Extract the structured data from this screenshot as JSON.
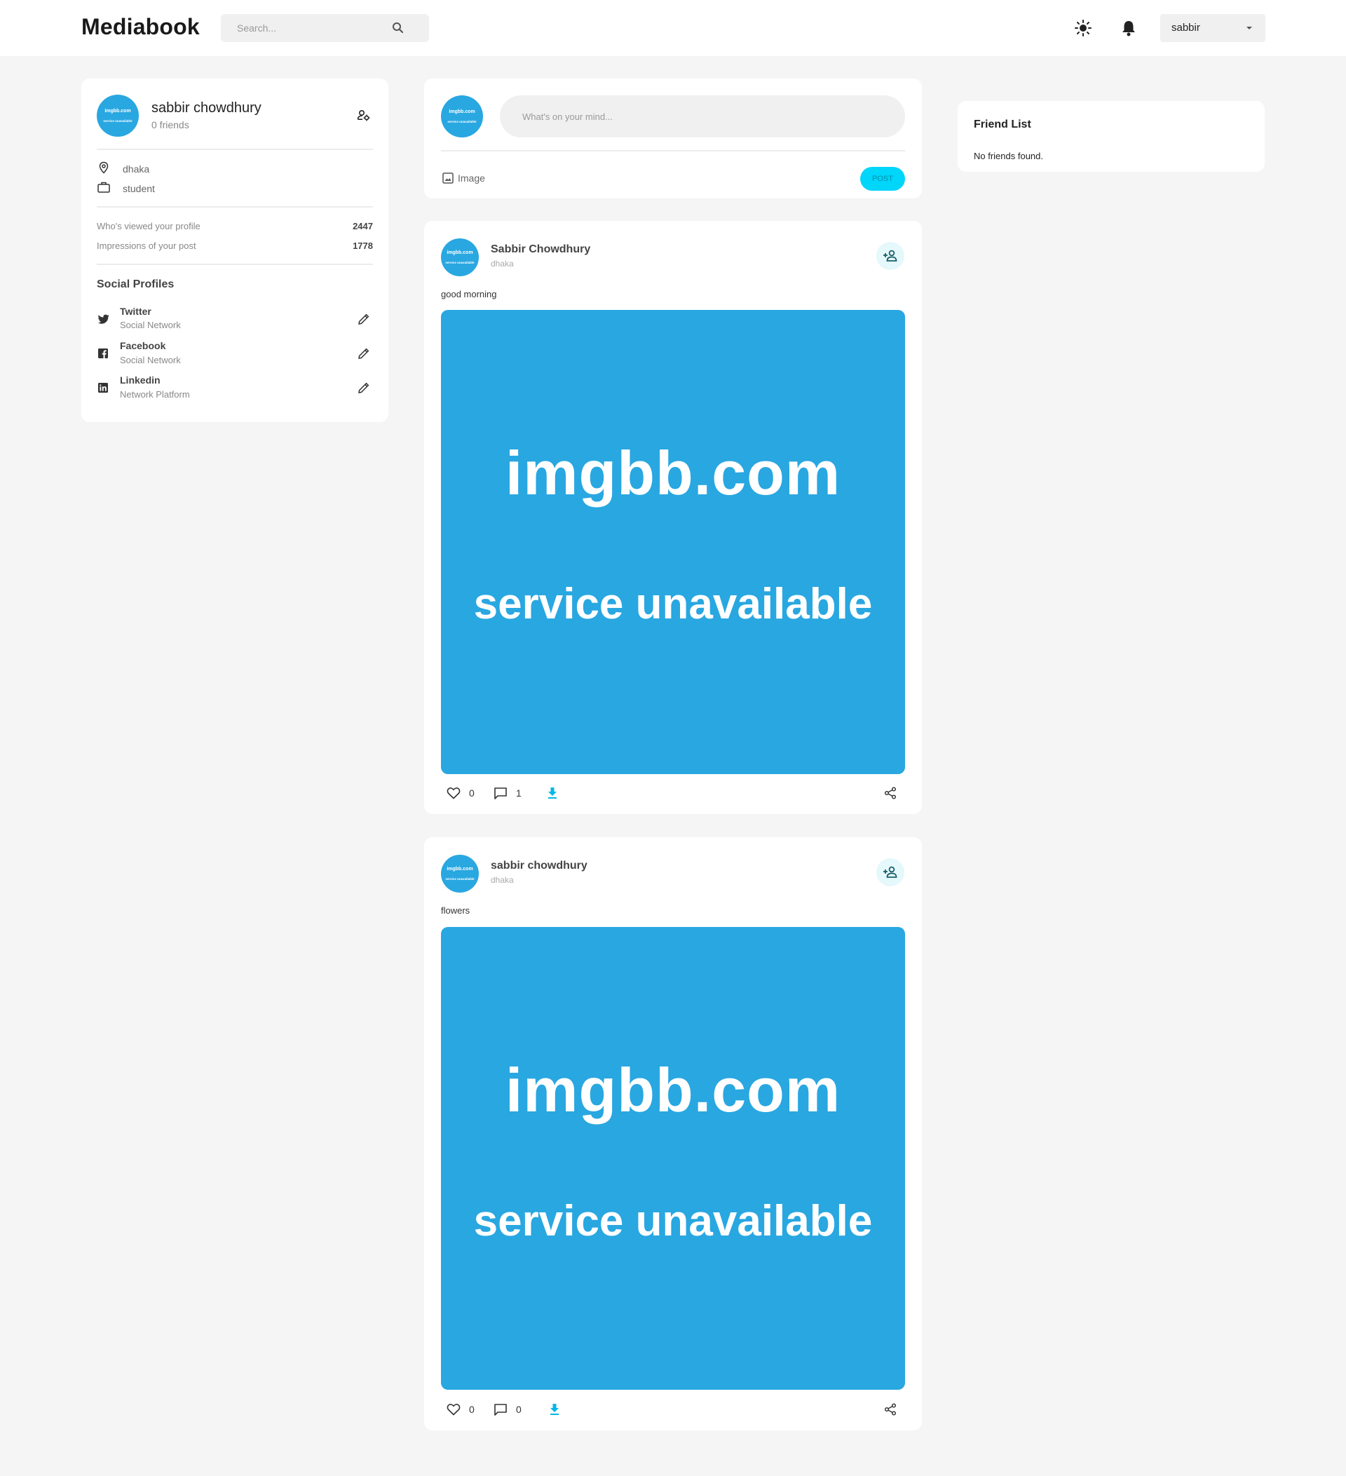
{
  "navbar": {
    "logo": "Mediabook",
    "search_placeholder": "Search...",
    "user_name": "sabbir"
  },
  "profile": {
    "avatar_line1": "imgbb.com",
    "avatar_line2": "service unavailable",
    "name": "sabbir chowdhury",
    "friends": "0 friends",
    "location": "dhaka",
    "occupation": "student",
    "stats": [
      {
        "label": "Who's viewed your profile",
        "value": "2447"
      },
      {
        "label": "Impressions of your post",
        "value": "1778"
      }
    ],
    "social_heading": "Social Profiles",
    "socials": [
      {
        "name": "Twitter",
        "desc": "Social Network",
        "icon": "twitter-icon"
      },
      {
        "name": "Facebook",
        "desc": "Social Network",
        "icon": "facebook-icon"
      },
      {
        "name": "Linkedin",
        "desc": "Network Platform",
        "icon": "linkedin-icon"
      }
    ]
  },
  "composer": {
    "placeholder": "What's on your mind...",
    "image_label": "Image",
    "post_label": "POST"
  },
  "posts": [
    {
      "author": "Sabbir Chowdhury",
      "location": "dhaka",
      "text": "good morning",
      "image_line1": "imgbb.com",
      "image_line2": "service unavailable",
      "likes": "0",
      "comments": "1"
    },
    {
      "author": "sabbir chowdhury",
      "location": "dhaka",
      "text": "flowers",
      "image_line1": "imgbb.com",
      "image_line2": "service unavailable",
      "likes": "0",
      "comments": "0"
    }
  ],
  "friend_list": {
    "title": "Friend List",
    "empty": "No friends found."
  },
  "colors": {
    "accent": "#00d5fa",
    "avatar_blue": "#29a7e1",
    "background": "#f5f5f5"
  }
}
